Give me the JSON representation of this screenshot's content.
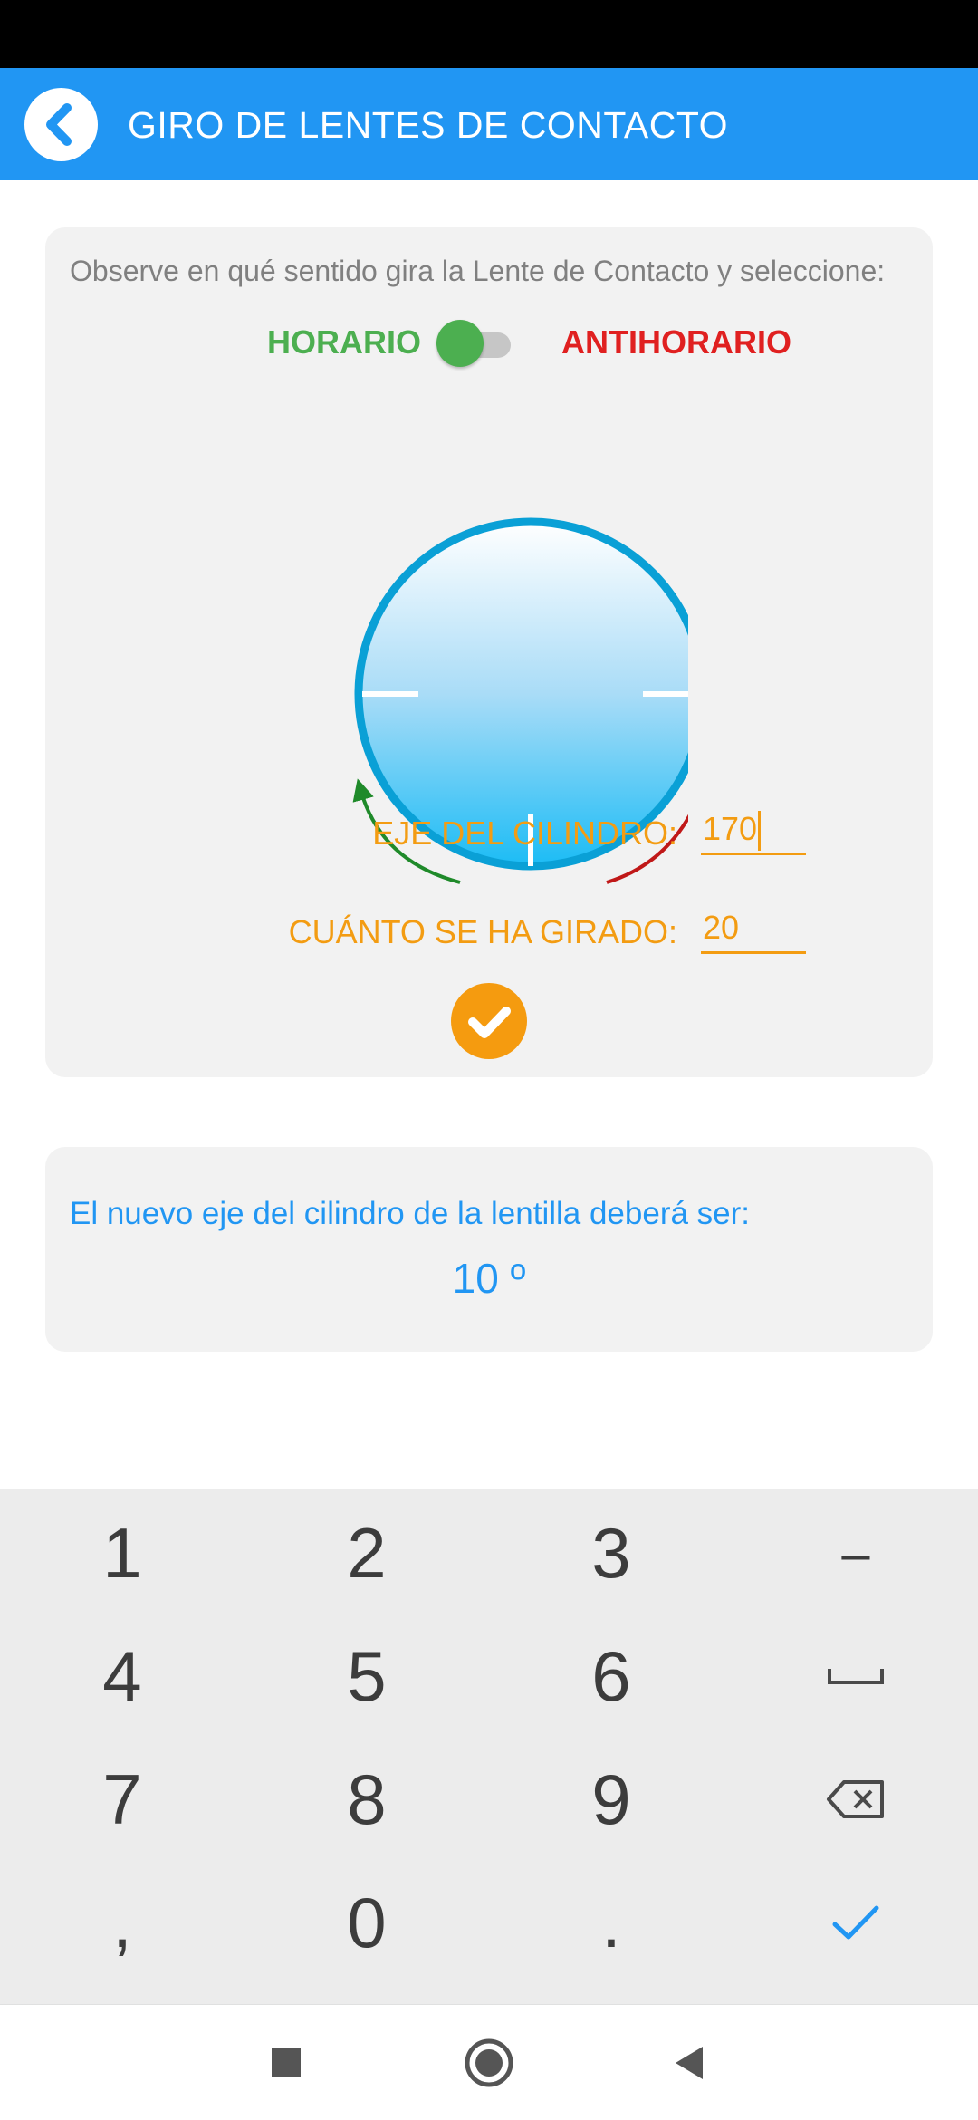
{
  "app_bar": {
    "title": "GIRO DE LENTES DE CONTACTO",
    "color": "#2196F3"
  },
  "rotation_card": {
    "instruction": "Observe en qué sentido gira la Lente de Contacto y seleccione:",
    "clockwise_label": "HORARIO",
    "counterclockwise_label": "ANTIHORARIO",
    "direction_toggle": {
      "selected": "HORARIO",
      "on": false
    },
    "cylinder_axis": {
      "label": "EJE DEL CILINDRO:",
      "value": "170"
    },
    "rotation_amount": {
      "label": "CUÁNTO SE HA GIRADO:",
      "value": "20"
    },
    "confirm_icon": "check-circle-icon",
    "colors": {
      "clockwise": "#4CAF50",
      "counterclockwise": "#E02020",
      "accent": "#F39C12"
    }
  },
  "result_card": {
    "text": "El nuevo eje del cilindro de la lentilla deberá ser:",
    "value": "10 º"
  },
  "keyboard": {
    "keys": [
      {
        "name": "key-1",
        "label": "1"
      },
      {
        "name": "key-2",
        "label": "2"
      },
      {
        "name": "key-3",
        "label": "3"
      },
      {
        "name": "key-minus",
        "label": "–"
      },
      {
        "name": "key-4",
        "label": "4"
      },
      {
        "name": "key-5",
        "label": "5"
      },
      {
        "name": "key-6",
        "label": "6"
      },
      {
        "name": "key-space",
        "icon": "space-bar-icon"
      },
      {
        "name": "key-7",
        "label": "7"
      },
      {
        "name": "key-8",
        "label": "8"
      },
      {
        "name": "key-9",
        "label": "9"
      },
      {
        "name": "key-backspace",
        "icon": "backspace-icon"
      },
      {
        "name": "key-comma",
        "label": ","
      },
      {
        "name": "key-0",
        "label": "0"
      },
      {
        "name": "key-period",
        "label": "."
      },
      {
        "name": "key-done",
        "icon": "check-icon"
      }
    ]
  },
  "nav_bar": {
    "icons": [
      "recents-square-icon",
      "home-circle-icon",
      "back-triangle-icon"
    ]
  }
}
